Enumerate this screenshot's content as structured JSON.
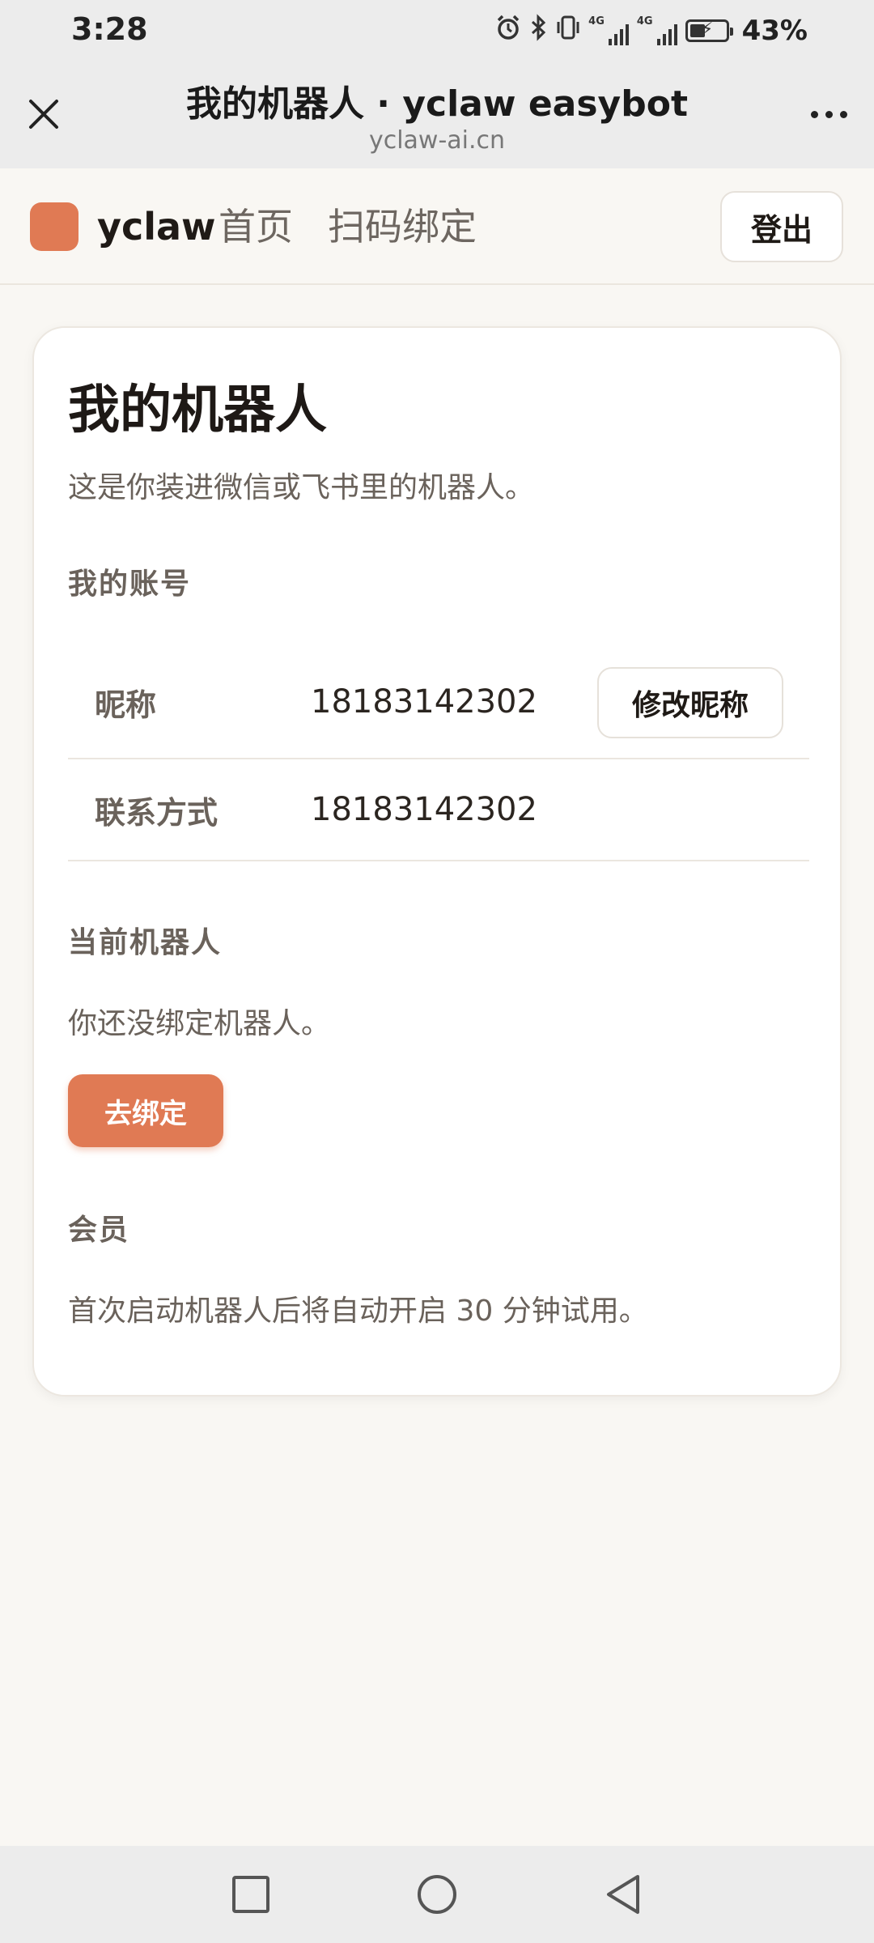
{
  "status_bar": {
    "time": "3:28",
    "network_1": "4G",
    "network_2": "4G",
    "battery": "43%",
    "battery_level": 0.43,
    "icons": [
      "alarm-icon",
      "bluetooth-icon",
      "vibrate-icon",
      "signal-icon",
      "signal-icon",
      "battery-icon"
    ]
  },
  "browser": {
    "title": "我的机器人 · yclaw easybot",
    "domain": "yclaw-ai.cn",
    "close_icon": "close-icon",
    "more_icon": "more-icon"
  },
  "header": {
    "brand": "yclaw",
    "nav": [
      "首页",
      "扫码绑定"
    ],
    "logout": "登出",
    "accent": "#e07a54"
  },
  "card": {
    "title": "我的机器人",
    "description": "这是你装进微信或飞书里的机器人。",
    "account_section": "我的账号",
    "account_rows": [
      {
        "label": "昵称",
        "value": "18183142302",
        "action": "修改昵称"
      },
      {
        "label": "联系方式",
        "value": "18183142302"
      }
    ],
    "robot_section": "当前机器人",
    "robot_status": "你还没绑定机器人。",
    "bind_button": "去绑定",
    "membership_section": "会员",
    "membership_text": "首次启动机器人后将自动开启 30 分钟试用。"
  },
  "system_nav": {
    "buttons": [
      "recent-apps-icon",
      "home-icon",
      "back-icon"
    ]
  }
}
